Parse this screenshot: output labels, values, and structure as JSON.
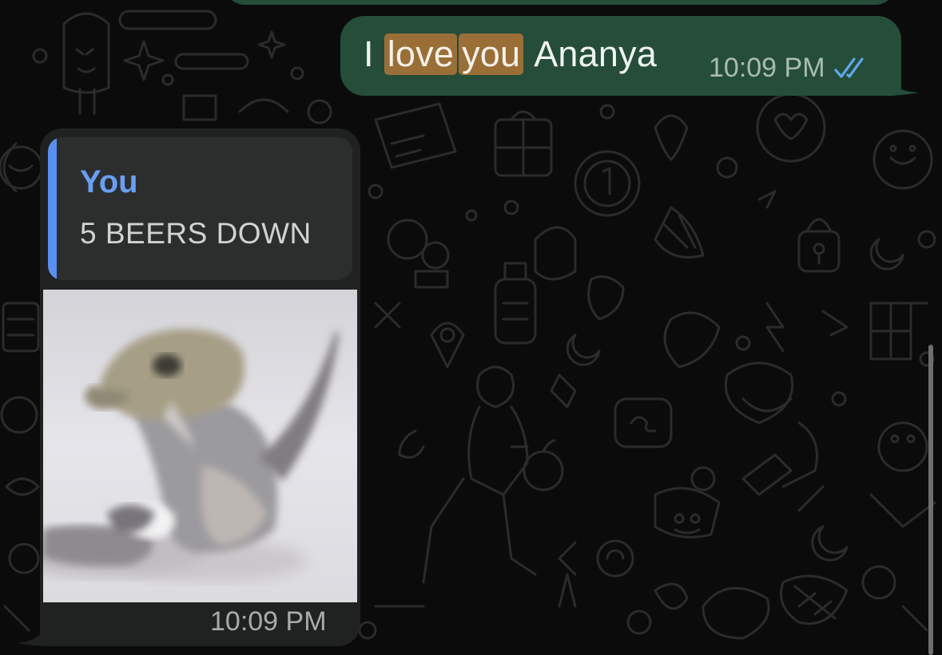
{
  "conversation": {
    "outgoing_message": {
      "pre_text": "I",
      "highlight_1": "love",
      "highlight_2": "you",
      "post_text": "Ananya",
      "time": "10:09 PM",
      "status_icon": "double-check-read-icon"
    },
    "incoming_message": {
      "quote_author": "You",
      "quote_text": "5 BEERS DOWN",
      "media_type": "gif",
      "time": "10:09 PM"
    }
  },
  "colors": {
    "background": "#0b0b0b",
    "outgoing_bubble": "#254d3a",
    "incoming_bubble": "#202222",
    "quote_card": "#2c2e2e",
    "quote_accent": "#5a8ef0",
    "search_highlight": "#9a6f37",
    "read_ticks": "#5fa8e8"
  }
}
